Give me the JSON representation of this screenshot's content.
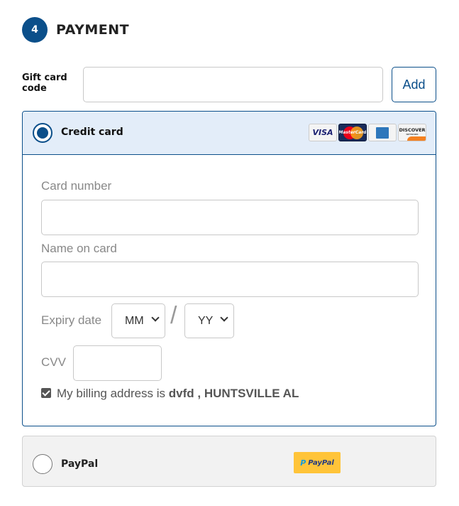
{
  "step": {
    "number": "4",
    "title": "PAYMENT"
  },
  "gift_card": {
    "label": "Gift card code",
    "value": "",
    "placeholder": "",
    "button_label": "Add"
  },
  "credit_card": {
    "title": "Credit card",
    "selected": true,
    "logos": [
      "VISA",
      "MasterCard",
      "Amex",
      "DISCOVER"
    ],
    "logo_texts": {
      "visa": "VISA",
      "mastercard": "MasterCard",
      "discover": "DISCOVER",
      "discover_sub": "NETWORK"
    },
    "fields": {
      "card_number_label": "Card number",
      "name_on_card_label": "Name on card",
      "expiry_label": "Expiry date",
      "expiry_month": "MM",
      "expiry_separator": "/",
      "expiry_year": "YY",
      "cvv_label": "CVV"
    },
    "billing": {
      "checked": true,
      "prefix": "My billing address is",
      "address": "dvfd , HUNTSVILLE AL"
    }
  },
  "paypal": {
    "title": "PayPal",
    "selected": false,
    "logo_text": "PayPal",
    "logo_mark": "P"
  },
  "colors": {
    "primary": "#0b4f8a",
    "selected_bg": "#e3edf9",
    "paypal_yellow": "#ffc439"
  }
}
